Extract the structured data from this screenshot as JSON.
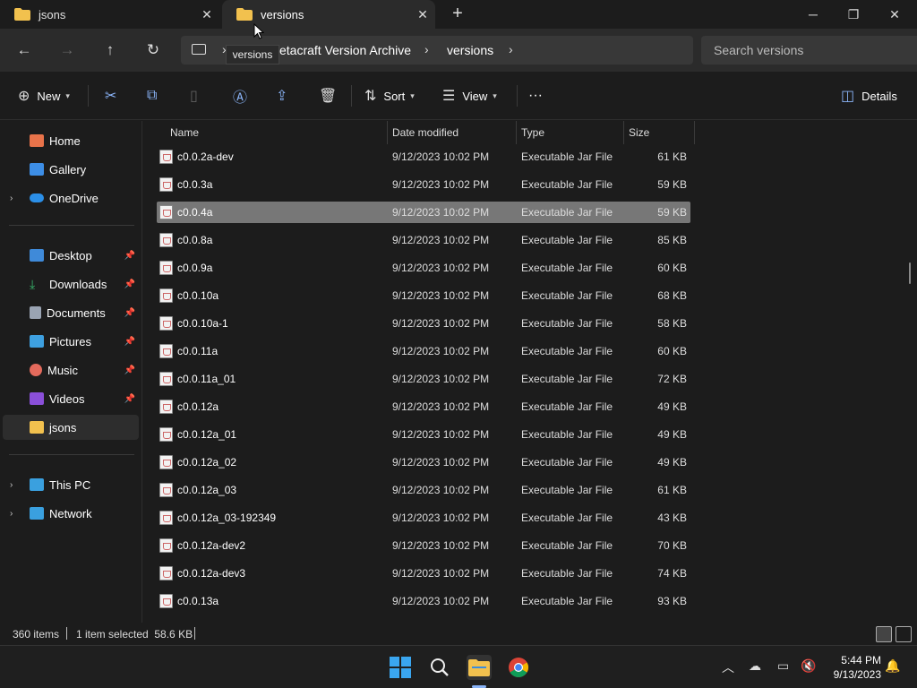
{
  "tabs": [
    {
      "label": "jsons",
      "close": "✕",
      "active": false
    },
    {
      "label": "versions",
      "close": "✕",
      "active": true
    }
  ],
  "window_controls": {
    "minimize": "─",
    "maximize": "❐",
    "close": "✕"
  },
  "new_tab": "+",
  "tooltip": "versions",
  "address": {
    "crumbs": [
      "etacraft Version Archive",
      "versions"
    ],
    "separator": "›"
  },
  "search": {
    "placeholder": "Search versions"
  },
  "commands": {
    "new": "New",
    "sort": "Sort",
    "view": "View",
    "more": "···",
    "details": "Details"
  },
  "sidebar": {
    "items": [
      {
        "label": "Home",
        "color": "#e8734a"
      },
      {
        "label": "Gallery",
        "color": "#3d8ee6"
      },
      {
        "label": "OneDrive",
        "color": "#2b8fe8"
      },
      {
        "label": "Desktop",
        "color": "#3f8ad9"
      },
      {
        "label": "Downloads",
        "color": "#39b86e"
      },
      {
        "label": "Documents",
        "color": "#9aa4b3"
      },
      {
        "label": "Pictures",
        "color": "#3ea0e0"
      },
      {
        "label": "Music",
        "color": "#e46a5c"
      },
      {
        "label": "Videos",
        "color": "#8a4fd9"
      },
      {
        "label": "jsons",
        "color": "#f2c14e"
      },
      {
        "label": "This PC",
        "color": "#3aa0df"
      },
      {
        "label": "Network",
        "color": "#3aa0df"
      }
    ]
  },
  "columns": {
    "name": "Name",
    "date": "Date modified",
    "type": "Type",
    "size": "Size"
  },
  "files": [
    {
      "name": "c0.0.2a-dev",
      "date": "9/12/2023 10:02 PM",
      "type": "Executable Jar File",
      "size": "61 KB"
    },
    {
      "name": "c0.0.3a",
      "date": "9/12/2023 10:02 PM",
      "type": "Executable Jar File",
      "size": "59 KB"
    },
    {
      "name": "c0.0.4a",
      "date": "9/12/2023 10:02 PM",
      "type": "Executable Jar File",
      "size": "59 KB"
    },
    {
      "name": "c0.0.8a",
      "date": "9/12/2023 10:02 PM",
      "type": "Executable Jar File",
      "size": "85 KB"
    },
    {
      "name": "c0.0.9a",
      "date": "9/12/2023 10:02 PM",
      "type": "Executable Jar File",
      "size": "60 KB"
    },
    {
      "name": "c0.0.10a",
      "date": "9/12/2023 10:02 PM",
      "type": "Executable Jar File",
      "size": "68 KB"
    },
    {
      "name": "c0.0.10a-1",
      "date": "9/12/2023 10:02 PM",
      "type": "Executable Jar File",
      "size": "58 KB"
    },
    {
      "name": "c0.0.11a",
      "date": "9/12/2023 10:02 PM",
      "type": "Executable Jar File",
      "size": "60 KB"
    },
    {
      "name": "c0.0.11a_01",
      "date": "9/12/2023 10:02 PM",
      "type": "Executable Jar File",
      "size": "72 KB"
    },
    {
      "name": "c0.0.12a",
      "date": "9/12/2023 10:02 PM",
      "type": "Executable Jar File",
      "size": "49 KB"
    },
    {
      "name": "c0.0.12a_01",
      "date": "9/12/2023 10:02 PM",
      "type": "Executable Jar File",
      "size": "49 KB"
    },
    {
      "name": "c0.0.12a_02",
      "date": "9/12/2023 10:02 PM",
      "type": "Executable Jar File",
      "size": "49 KB"
    },
    {
      "name": "c0.0.12a_03",
      "date": "9/12/2023 10:02 PM",
      "type": "Executable Jar File",
      "size": "61 KB"
    },
    {
      "name": "c0.0.12a_03-192349",
      "date": "9/12/2023 10:02 PM",
      "type": "Executable Jar File",
      "size": "43 KB"
    },
    {
      "name": "c0.0.12a-dev2",
      "date": "9/12/2023 10:02 PM",
      "type": "Executable Jar File",
      "size": "70 KB"
    },
    {
      "name": "c0.0.12a-dev3",
      "date": "9/12/2023 10:02 PM",
      "type": "Executable Jar File",
      "size": "74 KB"
    },
    {
      "name": "c0.0.13a",
      "date": "9/12/2023 10:02 PM",
      "type": "Executable Jar File",
      "size": "93 KB"
    }
  ],
  "selected_file": "c0.0.4a",
  "status": {
    "items": "360 items",
    "selected": "1 item selected  58.6 KB"
  },
  "clock": {
    "time": "5:44 PM",
    "date": "9/13/2023"
  },
  "colors": {
    "accent": "#8ab4f8",
    "folder": "#f2c14e",
    "selected_row": "#777777"
  }
}
